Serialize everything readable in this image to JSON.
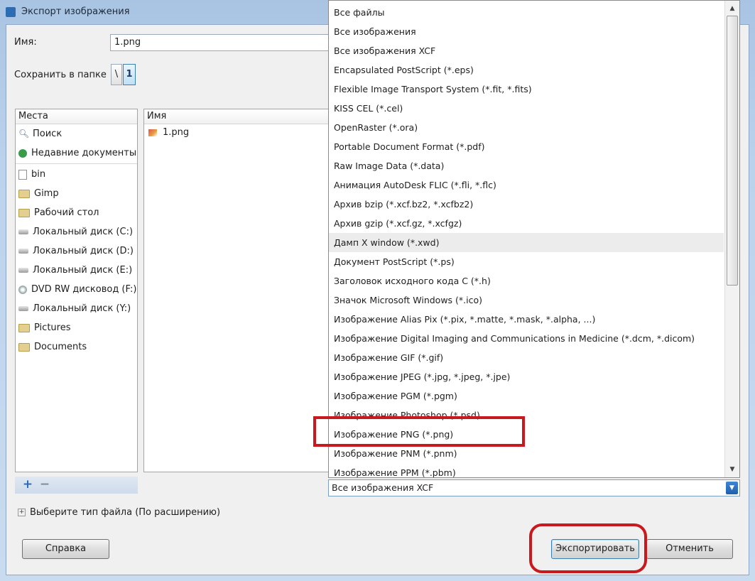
{
  "window": {
    "title": "Экспорт изображения"
  },
  "form": {
    "name_label": "Имя:",
    "name_value": "1.png",
    "folder_label": "Сохранить в папке",
    "path_buttons": [
      "\\",
      "1"
    ]
  },
  "places": {
    "header": "Места",
    "items": [
      {
        "label": "Поиск",
        "icon": "search-icon"
      },
      {
        "label": "Недавние документы",
        "icon": "recent-icon"
      },
      {
        "label": "bin",
        "icon": "file-icon"
      },
      {
        "label": "Gimp",
        "icon": "folder-icon"
      },
      {
        "label": "Рабочий стол",
        "icon": "folder-icon"
      },
      {
        "label": "Локальный диск (C:)",
        "icon": "drive-icon"
      },
      {
        "label": "Локальный диск (D:)",
        "icon": "drive-icon"
      },
      {
        "label": "Локальный диск (E:)",
        "icon": "drive-icon"
      },
      {
        "label": "DVD RW дисковод (F:)",
        "icon": "dvd-icon"
      },
      {
        "label": "Локальный диск (Y:)",
        "icon": "drive-icon"
      },
      {
        "label": "Pictures",
        "icon": "folder-icon"
      },
      {
        "label": "Documents",
        "icon": "folder-icon"
      }
    ],
    "add_symbol": "+",
    "remove_symbol": "−"
  },
  "files": {
    "header": "Имя",
    "rows": [
      "1.png"
    ]
  },
  "filetype_dropdown": {
    "items": [
      "Все файлы",
      "Все изображения",
      "Все изображения XCF",
      "Encapsulated PostScript (*.eps)",
      "Flexible Image Transport System (*.fit, *.fits)",
      "KISS CEL (*.cel)",
      "OpenRaster (*.ora)",
      "Portable Document Format (*.pdf)",
      "Raw Image Data (*.data)",
      "Анимация AutoDesk FLIC (*.fli, *.flc)",
      "Архив bzip (*.xcf.bz2, *.xcfbz2)",
      "Архив gzip (*.xcf.gz, *.xcfgz)",
      "Дамп X window (*.xwd)",
      "Документ PostScript (*.ps)",
      "Заголовок исходного кода C (*.h)",
      "Значок Microsoft Windows (*.ico)",
      "Изображение Alias Pix (*.pix, *.matte, *.mask, *.alpha, ...)",
      "Изображение Digital Imaging and Communications in Medicine (*.dcm, *.dicom)",
      "Изображение GIF (*.gif)",
      "Изображение JPEG (*.jpg, *.jpeg, *.jpe)",
      "Изображение PGM (*.pgm)",
      "Изображение Photoshop (*.psd)",
      "Изображение PNG (*.png)",
      "Изображение PNM (*.pnm)",
      "Изображение PPM (*.pbm)"
    ],
    "hovered_index": 12,
    "selected_value": "Все изображения XCF"
  },
  "expander": {
    "label": "Выберите тип файла (По расширению)"
  },
  "buttons": {
    "help": "Справка",
    "export": "Экспортировать",
    "cancel": "Отменить"
  },
  "colors": {
    "highlight_box": "#c8191e",
    "accent": "#3c7fb1"
  }
}
